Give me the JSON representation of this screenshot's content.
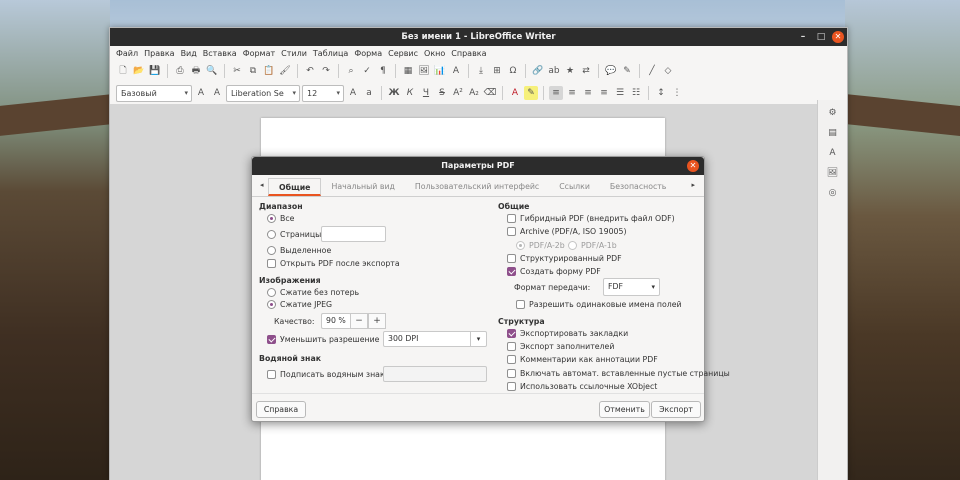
{
  "window": {
    "title": "Без имени 1 - LibreOffice Writer"
  },
  "menu": [
    "Файл",
    "Правка",
    "Вид",
    "Вставка",
    "Формат",
    "Стили",
    "Таблица",
    "Форма",
    "Сервис",
    "Окно",
    "Справка"
  ],
  "toolbar": {
    "style_value": "Базовый",
    "font_value": "Liberation Se",
    "size_value": "12"
  },
  "dialog": {
    "title": "Параметры PDF",
    "tabs": [
      "Общие",
      "Начальный вид",
      "Пользовательский интерфейс",
      "Ссылки",
      "Безопасность"
    ],
    "range": {
      "heading": "Диапазон",
      "all": "Все",
      "pages": "Страницы:",
      "selection": "Выделенное",
      "open_after": "Открыть PDF после экспорта"
    },
    "images": {
      "heading": "Изображения",
      "lossless": "Сжатие без потерь",
      "jpeg": "Сжатие JPEG",
      "quality_label": "Качество:",
      "quality_value": "90 %",
      "reduce_res": "Уменьшить разрешение",
      "dpi_value": "300 DPI"
    },
    "watermark": {
      "heading": "Водяной знак",
      "sign": "Подписать водяным знаком"
    },
    "general": {
      "heading": "Общие",
      "hybrid": "Гибридный PDF (внедрить файл ODF)",
      "archive": "Archive (PDF/A, ISO 19005)",
      "pdfa2b": "PDF/A-2b",
      "pdfa1b": "PDF/A-1b",
      "tagged": "Структурированный PDF",
      "create_form": "Создать форму PDF",
      "submit_format_label": "Формат передачи:",
      "submit_format_value": "FDF",
      "allow_dup": "Разрешить одинаковые имена полей"
    },
    "structure": {
      "heading": "Структура",
      "bookmarks": "Экспортировать закладки",
      "placeholders": "Экспорт заполнителей",
      "comments": "Комментарии как аннотации PDF",
      "blank_pages": "Включать автомат. вставленные пустые страницы",
      "xobject": "Использовать ссылочные XObject"
    },
    "buttons": {
      "help": "Справка",
      "cancel": "Отменить",
      "export": "Экспорт"
    }
  }
}
